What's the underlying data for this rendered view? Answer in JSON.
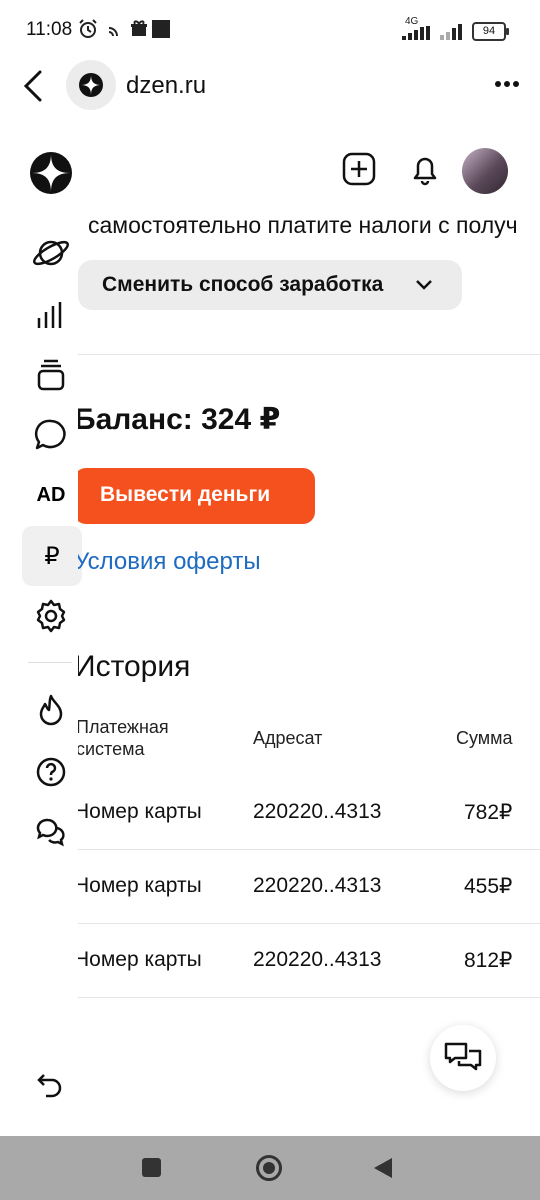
{
  "status_bar": {
    "time": "11:08",
    "network": "4G",
    "battery": "94"
  },
  "browser": {
    "url": "dzen.ru"
  },
  "main": {
    "income_note": "самостоятельно платите налоги с получ",
    "change_method_label": "Сменить способ заработка",
    "balance_label": "Баланс: 324 ₽",
    "withdraw_label": "Вывести деньги",
    "offer_link": "Условия оферты",
    "history_title": "История",
    "table": {
      "headers": [
        "Платежная система",
        "Адресат",
        "Сумма"
      ],
      "rows": [
        {
          "system": "Номер карты",
          "recipient": "220220..4313",
          "amount": "782₽"
        },
        {
          "system": "Номер карты",
          "recipient": "220220..4313",
          "amount": "455₽"
        },
        {
          "system": "Номер карты",
          "recipient": "220220..4313",
          "amount": "812₽"
        }
      ]
    }
  },
  "sidebar": {
    "items": [
      "zen-logo-icon",
      "planet-icon",
      "stats-icon",
      "layers-icon",
      "comments-icon",
      "AD",
      "ruble-icon",
      "settings-icon",
      "fire-icon",
      "help-icon",
      "chat-icon",
      "undo-icon"
    ],
    "ad_label": "AD",
    "ruble_label": "₽"
  },
  "colors": {
    "accent": "#f4511e",
    "link": "#1e6bc2",
    "nav_bar": "#a9a9a9"
  }
}
